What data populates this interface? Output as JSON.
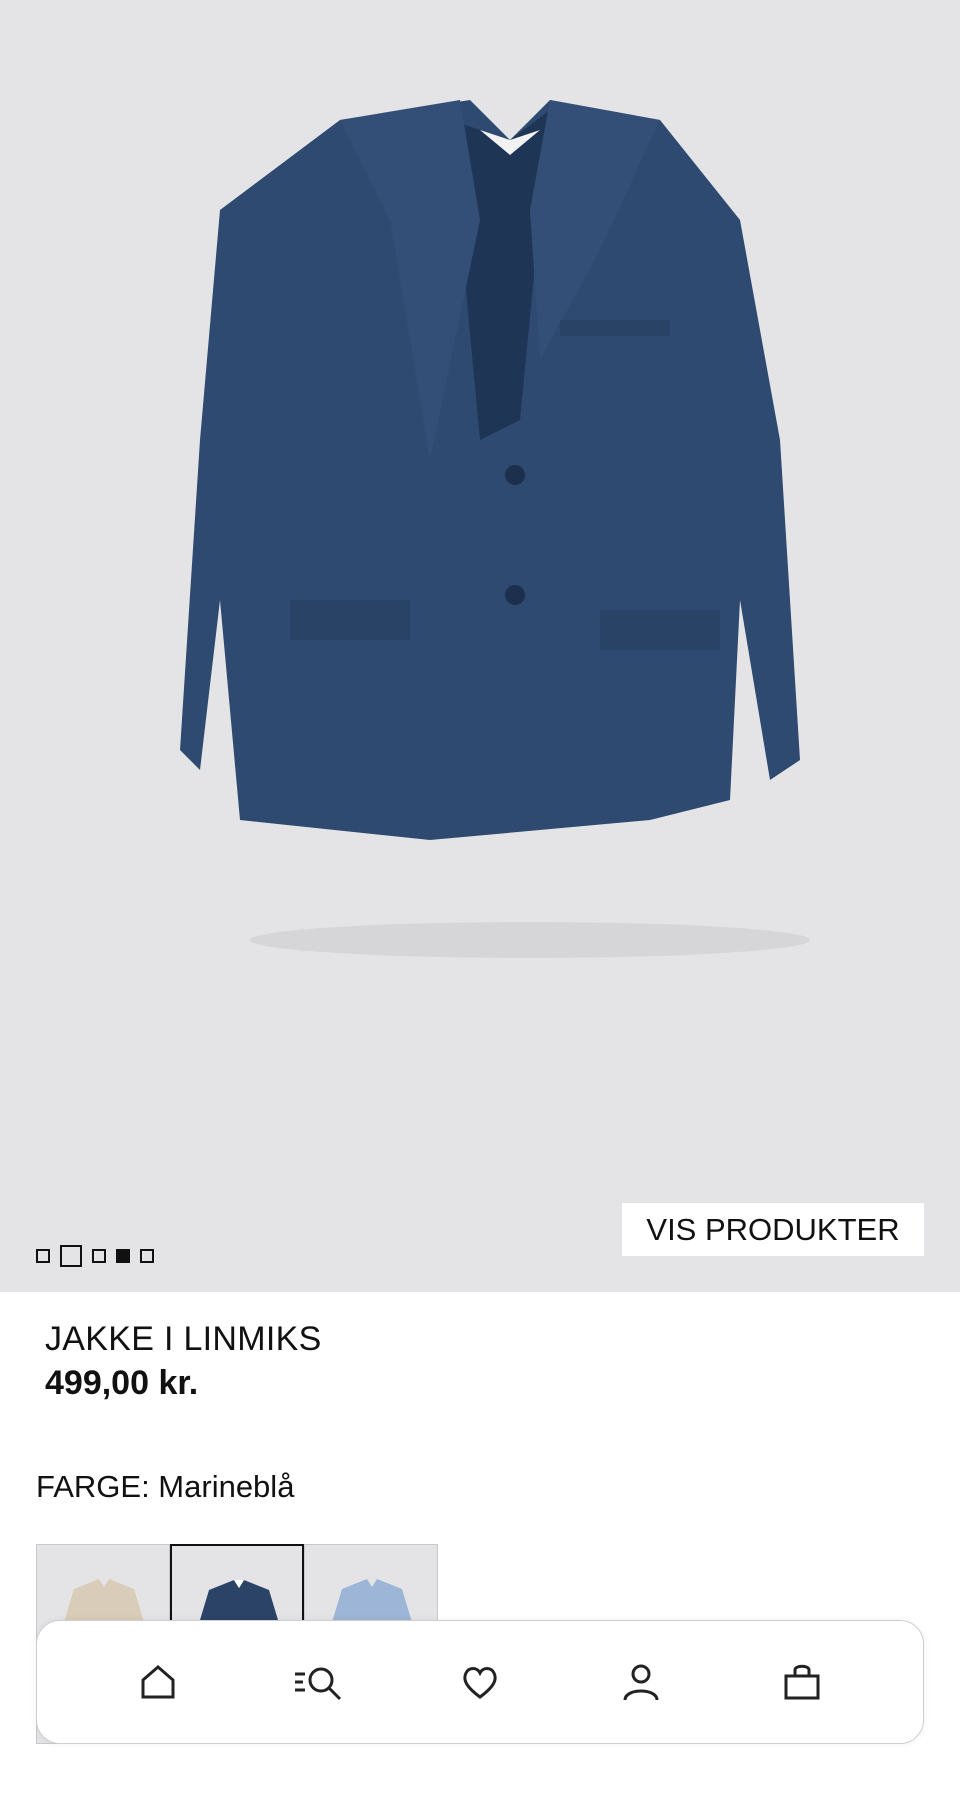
{
  "hero": {
    "vis_produkter_label": "VIS PRODUKTER",
    "carousel": {
      "count": 5,
      "current_index": 3
    }
  },
  "product": {
    "title": "JAKKE I LINMIKS",
    "price": "499,00 kr.",
    "color_label": "FARGE: Marineblå"
  },
  "swatches": [
    {
      "name": "beige",
      "color": "#d9ccb8",
      "selected": false
    },
    {
      "name": "marineblå",
      "color": "#2b4366",
      "selected": true
    },
    {
      "name": "lyseblå",
      "color": "#9db5d6",
      "selected": false
    }
  ],
  "nav": {
    "items": [
      "home-icon",
      "search-icon",
      "heart-icon",
      "user-icon",
      "bag-icon"
    ]
  },
  "colors": {
    "jacket": "#2e4a70",
    "hero_bg": "#e4e4e6"
  }
}
